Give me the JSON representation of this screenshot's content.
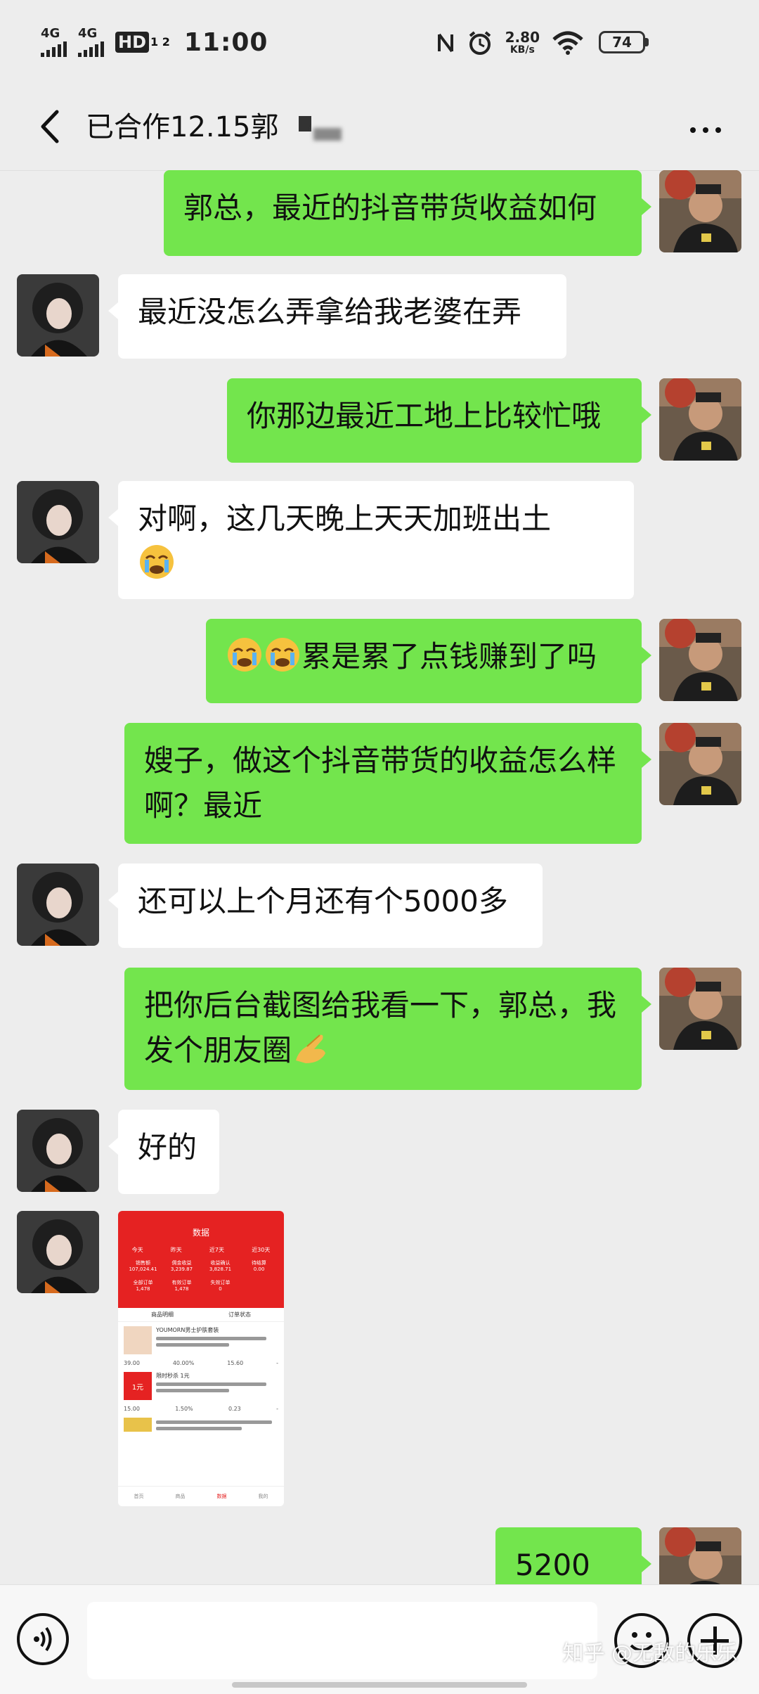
{
  "status_bar": {
    "sim1": "4G",
    "sim2": "4G",
    "hd": "HD",
    "hd_sub": "1 2",
    "time": "11:00",
    "net_speed": "2.80",
    "net_unit": "KB/s",
    "battery": "74"
  },
  "header": {
    "title": "已合作12.15郭"
  },
  "messages": [
    {
      "side": "right",
      "text": "郭总，最近的抖音带货收益如何"
    },
    {
      "side": "left",
      "text": "最近没怎么弄拿给我老婆在弄"
    },
    {
      "side": "right",
      "text": "你那边最近工地上比较忙哦"
    },
    {
      "side": "left",
      "text": "对啊，这几天晚上天天加班出土"
    },
    {
      "side": "right",
      "text": "累是累了点钱赚到了吗"
    },
    {
      "side": "right",
      "text": "嫂子，做这个抖音带货的收益怎么样啊？最近"
    },
    {
      "side": "left",
      "text": "还可以上个月还有个5000多"
    },
    {
      "side": "right",
      "text": "把你后台截图给我看一下，郭总，我发个朋友圈"
    },
    {
      "side": "left",
      "text": "好的"
    },
    {
      "side": "right",
      "text": "5200"
    }
  ],
  "screenshot_image": {
    "title": "数据",
    "tabs": [
      "今天",
      "昨天",
      "近7天",
      "近30天"
    ],
    "stats": [
      {
        "label": "销售额",
        "value": "107,024.41"
      },
      {
        "label": "佣金收益",
        "value": "3,239.87"
      },
      {
        "label": "收益确认",
        "value": "3,828.71"
      },
      {
        "label": "待结算",
        "value": "0.00"
      },
      {
        "label": "全部订单",
        "value": "1,478"
      },
      {
        "label": "有效订单",
        "value": "1,478"
      },
      {
        "label": "失效订单",
        "value": "0"
      }
    ],
    "list_tabs": [
      "商品明细",
      "订单状态"
    ],
    "products": [
      {
        "name": "YOUMORN男士护肤套装",
        "price": "39.00",
        "rate": "40.00%",
        "income": "15.60"
      },
      {
        "name": "限时秒杀 1元",
        "price": "15.00",
        "rate": "1.50%",
        "income": "0.23"
      }
    ],
    "nav": [
      "首页",
      "商品",
      "数据",
      "我的"
    ]
  },
  "input_bar": {
    "placeholder": ""
  },
  "watermark": "知乎 @无敌的乐乐",
  "colors": {
    "sent_bubble": "#73e54d",
    "received_bubble": "#ffffff",
    "background": "#ededed"
  },
  "icons": [
    "back-arrow-icon",
    "more-icon",
    "voice-icon",
    "emoji-icon",
    "plus-icon",
    "loudly-crying-emoji",
    "pinching-hand-emoji",
    "thumbs-up-emoji"
  ]
}
